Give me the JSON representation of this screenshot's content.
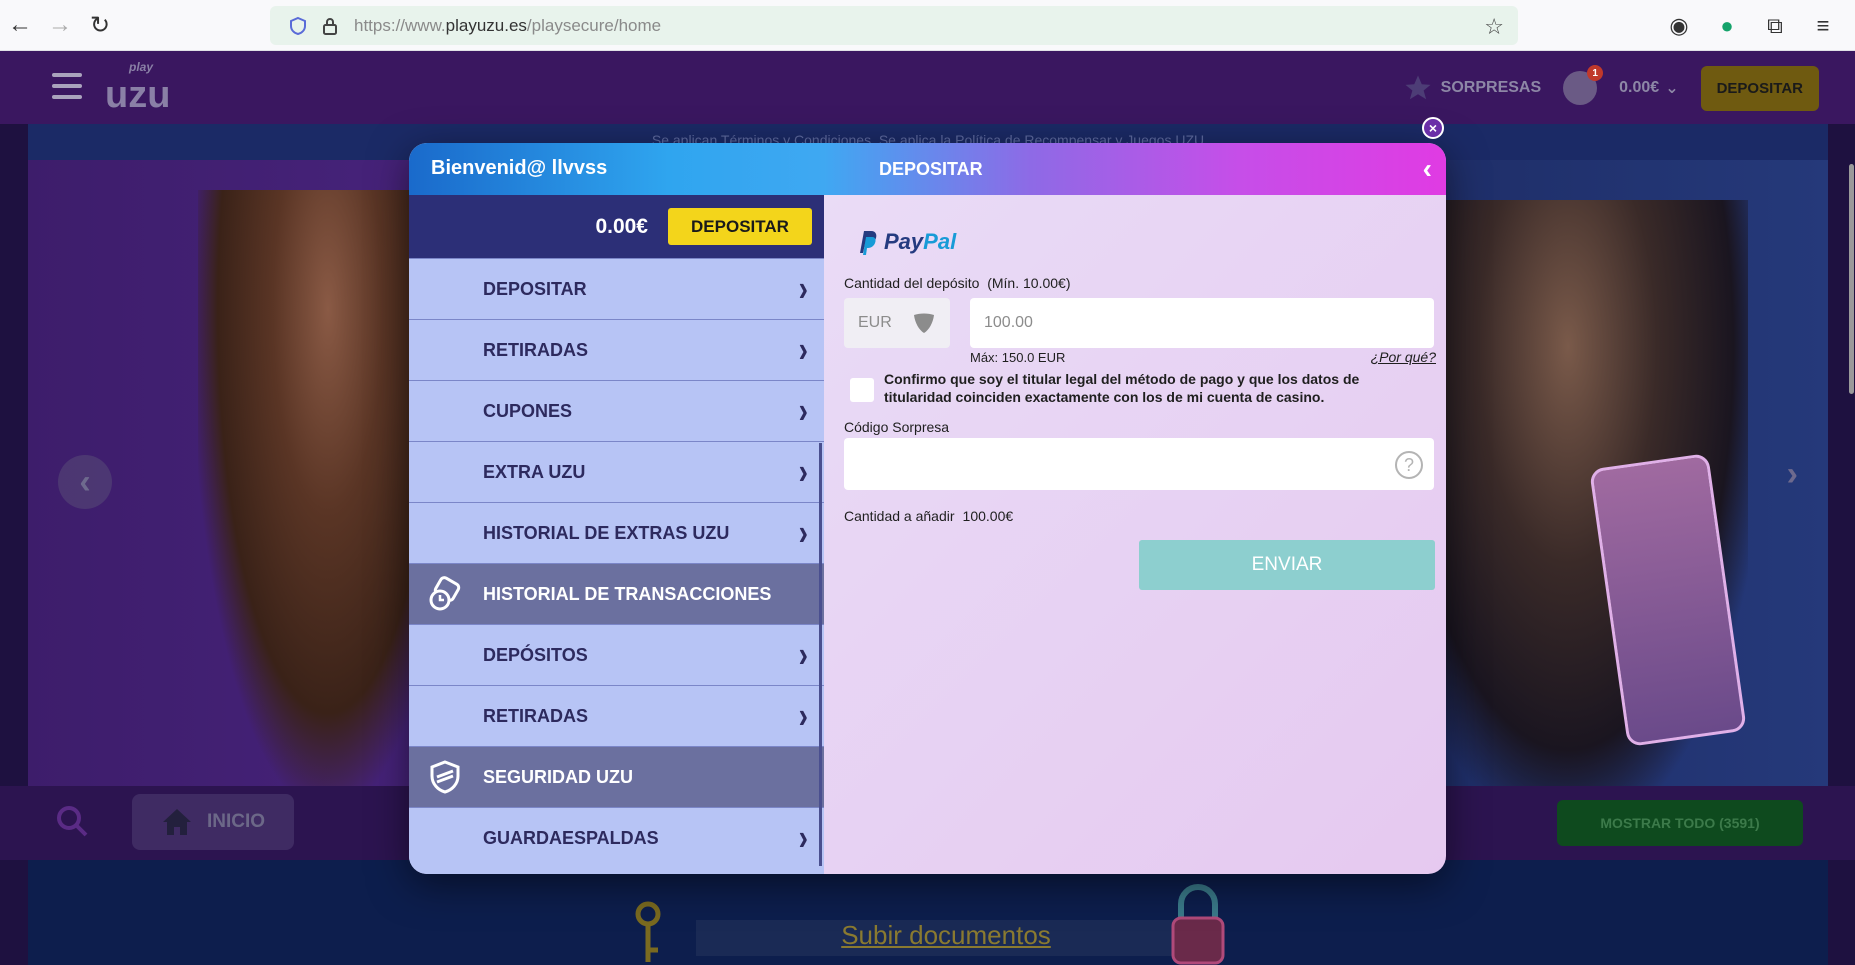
{
  "browser": {
    "url_prefix": "https://www.",
    "url_domain": "playuzu.es",
    "url_path": "/playsecure/home"
  },
  "header": {
    "logo_text": "play uzu",
    "sorpresas": "SORPRESAS",
    "notification_count": "1",
    "balance": "0.00€",
    "deposit_button": "DEPOSITAR"
  },
  "page": {
    "notice": "Se aplican Términos y Condiciones. Se aplica la Política de Recompensar y Juegos UZU",
    "inicio": "INICIO",
    "mostrar_todo": "MOSTRAR TODO (3591)",
    "subir_documentos": "Subir documentos"
  },
  "modal": {
    "welcome": "Bienvenid@ llvvss",
    "title": "DEPOSITAR",
    "side": {
      "balance": "0.00€",
      "deposit_button": "DEPOSITAR",
      "items": [
        {
          "label": "DEPOSITAR",
          "type": "link"
        },
        {
          "label": "RETIRADAS",
          "type": "link"
        },
        {
          "label": "CUPONES",
          "type": "link"
        },
        {
          "label": "EXTRA UZU",
          "type": "link"
        },
        {
          "label": "HISTORIAL DE EXTRAS UZU",
          "type": "link"
        },
        {
          "label": "HISTORIAL DE TRANSACCIONES",
          "type": "section"
        },
        {
          "label": "DEPÓSITOS",
          "type": "link"
        },
        {
          "label": "RETIRADAS",
          "type": "link"
        },
        {
          "label": "SEGURIDAD UZU",
          "type": "section"
        },
        {
          "label": "GUARDAESPALDAS",
          "type": "link"
        }
      ]
    },
    "paypal": {
      "brand_pay": "Pay",
      "brand_pal": "Pal",
      "amount_label": "Cantidad del depósito",
      "min_label": "(Mín. 10.00€)",
      "currency": "EUR",
      "amount_value": "100.00",
      "max_text": "Máx: 150.0 EUR",
      "why_link": "¿Por qué?",
      "confirm_text": "Confirmo que soy el titular legal del método de pago y que los datos de titularidad coinciden exactamente con los de mi cuenta de casino.",
      "code_label": "Código Sorpresa",
      "code_value": "",
      "to_add_label": "Cantidad a añadir",
      "to_add_value": "100.00€",
      "submit": "ENVIAR"
    }
  }
}
